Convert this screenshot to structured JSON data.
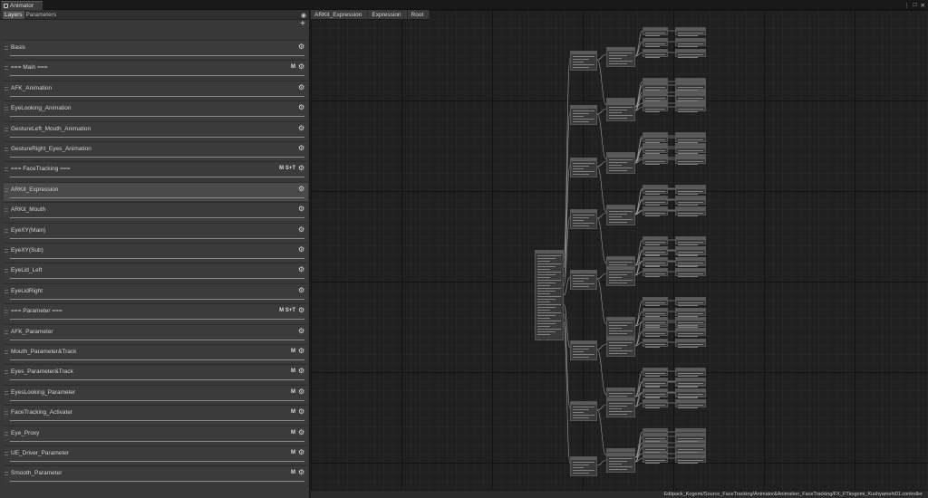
{
  "window": {
    "tab_title": "Animator",
    "controls": [
      "⋮",
      "□",
      "✕"
    ]
  },
  "tabs": [
    {
      "label": "Layers",
      "active": true
    },
    {
      "label": "Parameters",
      "active": false
    }
  ],
  "toolbar": {
    "add_icon": "+",
    "visibility_icon": "eye-icon"
  },
  "layers": [
    {
      "name": "Basis",
      "flags": ""
    },
    {
      "name": "=== Main ===",
      "flags": "M"
    },
    {
      "name": "AFK_Animation",
      "flags": ""
    },
    {
      "name": "EyeLooking_Animation",
      "flags": ""
    },
    {
      "name": "GestureLeft_Mouth_Animation",
      "flags": ""
    },
    {
      "name": "GestureRight_Eyes_Animation",
      "flags": ""
    },
    {
      "name": "=== FaceTracking ===",
      "flags": "M  S+T"
    },
    {
      "name": "ARKit_Expression",
      "flags": "",
      "selected": true
    },
    {
      "name": "ARKit_Mouth",
      "flags": ""
    },
    {
      "name": "EyeXY(Main)",
      "flags": ""
    },
    {
      "name": "EyeXY(Sub)",
      "flags": ""
    },
    {
      "name": "EyeLid_Left",
      "flags": ""
    },
    {
      "name": "EyeLidRight",
      "flags": ""
    },
    {
      "name": "=== Parameter ===",
      "flags": "M  S+T"
    },
    {
      "name": "AFK_Parameter",
      "flags": ""
    },
    {
      "name": "Mouth_Parameter&Track",
      "flags": "M"
    },
    {
      "name": "Eyes_Parameter&Track",
      "flags": "M"
    },
    {
      "name": "EyesLooking_Parameter",
      "flags": "M"
    },
    {
      "name": "FaceTracking_Activater",
      "flags": "M"
    },
    {
      "name": "Eye_Proxy",
      "flags": "M"
    },
    {
      "name": "UE_Driver_Parameter",
      "flags": "M"
    },
    {
      "name": "Smooth_Parameter",
      "flags": "M"
    }
  ],
  "breadcrumb": [
    "ARKit_Expression",
    "Expression",
    "Root"
  ],
  "status_path": "Editpack_Kogomi/Source_FaceTracking/Animator&Animation_FaceTracking/FX_FTkogomi_Kushyamehi01.controller"
}
